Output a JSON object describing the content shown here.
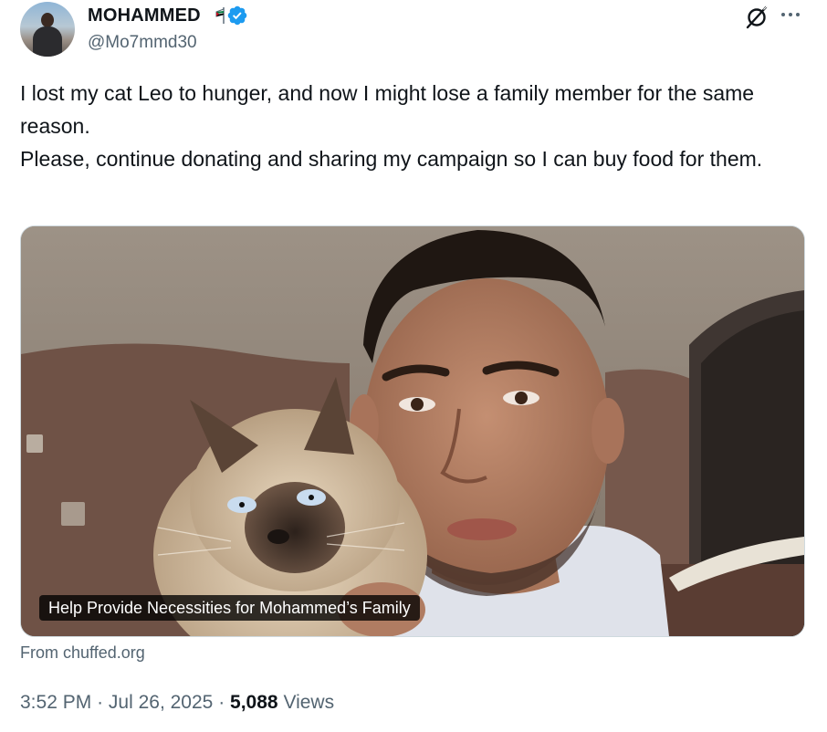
{
  "author": {
    "display_name": "MOHAMMED",
    "handle": "@Mo7mmd30"
  },
  "tweet": {
    "paragraph_1": "I lost my cat Leo to hunger, and now I might lose a family member for the same reason.",
    "paragraph_2": "Please, continue donating and sharing my campaign so I can buy food for them."
  },
  "card": {
    "title": "Help Provide Necessities for Mohammed’s Family",
    "source": "From chuffed.org"
  },
  "meta": {
    "time": "3:52 PM",
    "separator": "·",
    "date": "Jul 26, 2025",
    "views_count": "5,088",
    "views_label": "Views"
  },
  "icons": {
    "verified": "verified-badge-icon",
    "flag": "flag-icon",
    "grok": "grok-icon",
    "more": "more-options-icon"
  },
  "colors": {
    "verified_blue": "#1d9bf0",
    "text_primary": "#0f1419",
    "text_secondary": "#536471",
    "border": "#cfd9de"
  }
}
